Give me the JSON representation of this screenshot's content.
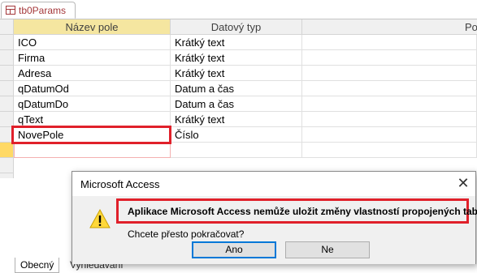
{
  "document_tab": {
    "label": "tb0Params"
  },
  "columns": {
    "field_name": "Název pole",
    "data_type": "Datový typ",
    "description": "Popis"
  },
  "rows": [
    {
      "name": "ICO",
      "type": "Krátký text"
    },
    {
      "name": "Firma",
      "type": "Krátký text"
    },
    {
      "name": "Adresa",
      "type": "Krátký text"
    },
    {
      "name": "qDatumOd",
      "type": "Datum a čas"
    },
    {
      "name": "qDatumDo",
      "type": "Datum a čas"
    },
    {
      "name": "qText",
      "type": "Krátký text"
    },
    {
      "name": "NovePole",
      "type": "Číslo"
    }
  ],
  "property_tabs": {
    "general": "Obecný",
    "lookup": "Vyhledávání"
  },
  "dialog": {
    "title": "Microsoft Access",
    "close_glyph": "✕",
    "message": "Aplikace Microsoft Access nemůže uložit změny vlastností propojených tabulek.",
    "question": "Chcete přesto pokračovat?",
    "yes_label": "Ano",
    "no_label": "Ne"
  },
  "colors": {
    "highlight_red": "#e0202a",
    "tab_text": "#a4373a",
    "current_row": "#ffd965"
  }
}
